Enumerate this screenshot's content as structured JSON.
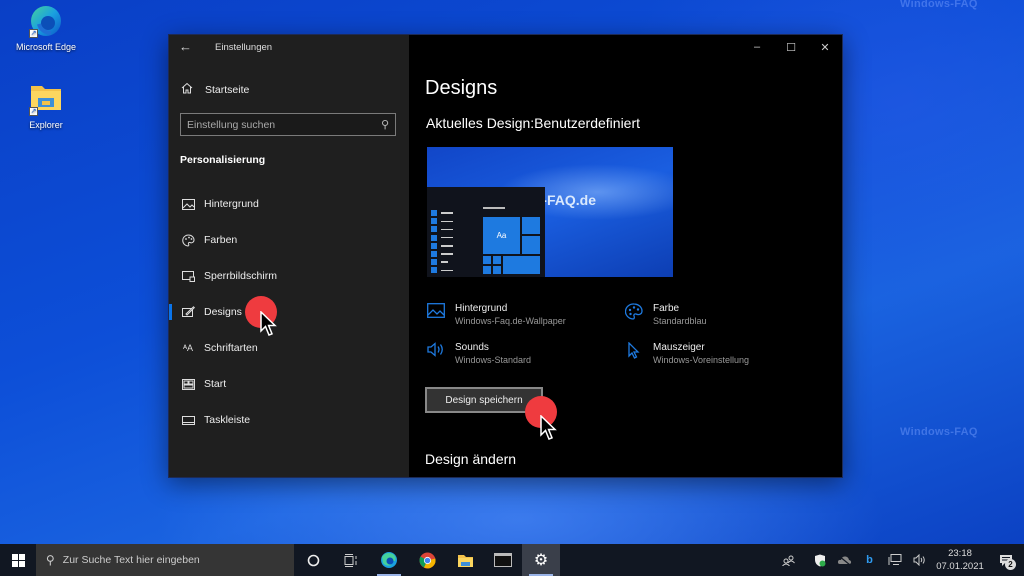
{
  "desktop": {
    "watermark": "Windows-FAQ",
    "icons": [
      {
        "label": "Microsoft Edge",
        "icon": "edge-icon"
      },
      {
        "label": "Explorer",
        "icon": "folder-icon"
      }
    ]
  },
  "window": {
    "title": "Einstellungen",
    "controls": {
      "minimize": "–",
      "maximize": "☐",
      "close": "✕"
    }
  },
  "sidebar": {
    "home_label": "Startseite",
    "search_placeholder": "Einstellung suchen",
    "section_title": "Personalisierung",
    "items": [
      {
        "label": "Hintergrund",
        "icon": "image-icon",
        "active": false
      },
      {
        "label": "Farben",
        "icon": "palette-icon",
        "active": false
      },
      {
        "label": "Sperrbildschirm",
        "icon": "lockscreen-icon",
        "active": false
      },
      {
        "label": "Designs",
        "icon": "brush-icon",
        "active": true
      },
      {
        "label": "Schriftarten",
        "icon": "fonts-icon",
        "active": false
      },
      {
        "label": "Start",
        "icon": "start-icon",
        "active": false
      },
      {
        "label": "Taskleiste",
        "icon": "taskbar-icon",
        "active": false
      }
    ]
  },
  "main": {
    "title": "Designs",
    "current_design_label": "Aktuelles Design:",
    "current_design_value": "Benutzerdefiniert",
    "preview": {
      "watermark": "Windows-FAQ.de",
      "tile_label": "Aa"
    },
    "properties": [
      {
        "title": "Hintergrund",
        "value": "Windows-Faq.de-Wallpaper",
        "icon": "image-icon"
      },
      {
        "title": "Farbe",
        "value": "Standardblau",
        "icon": "palette-icon"
      },
      {
        "title": "Sounds",
        "value": "Windows-Standard",
        "icon": "speaker-icon"
      },
      {
        "title": "Mauszeiger",
        "value": "Windows-Voreinstellung",
        "icon": "cursor-icon"
      }
    ],
    "save_button": "Design speichern",
    "change_heading": "Design ändern"
  },
  "taskbar": {
    "search_placeholder": "Zur Suche Text hier eingeben",
    "apps": [
      {
        "name": "cortana",
        "icon": "cortana-icon"
      },
      {
        "name": "task-view",
        "icon": "task-view-icon"
      },
      {
        "name": "edge",
        "icon": "edge-icon"
      },
      {
        "name": "chrome",
        "icon": "chrome-icon"
      },
      {
        "name": "explorer",
        "icon": "folder-icon"
      },
      {
        "name": "terminal",
        "icon": "terminal-icon"
      },
      {
        "name": "settings",
        "icon": "gear-icon"
      }
    ],
    "time": "23:18",
    "date": "07.01.2021",
    "notification_count": "2"
  },
  "colors": {
    "accent": "#0a74ea",
    "click_marker": "#ef3b3f"
  }
}
